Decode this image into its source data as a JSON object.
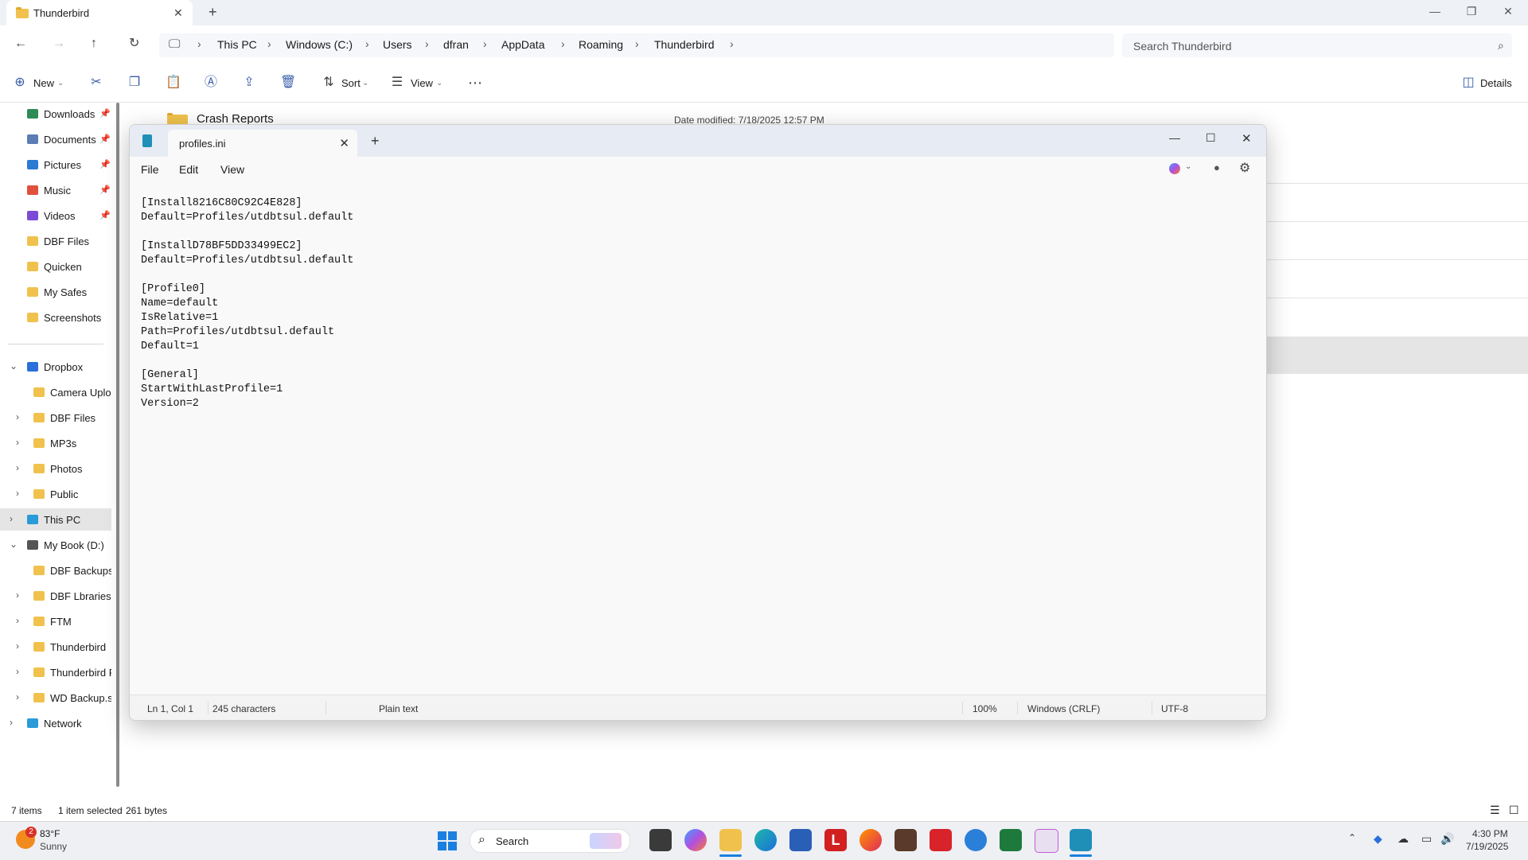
{
  "explorer": {
    "tab_title": "Thunderbird",
    "breadcrumbs": [
      "This PC",
      "Windows (C:)",
      "Users",
      "dfran",
      "AppData",
      "Roaming",
      "Thunderbird"
    ],
    "search_placeholder": "Search Thunderbird",
    "commands": {
      "new": "New",
      "sort": "Sort",
      "view": "View",
      "details": "Details"
    },
    "background_file": {
      "name": "Crash Reports",
      "date_modified": "Date modified: 7/18/2025 12:57 PM"
    },
    "sidebar": {
      "quick_access": [
        {
          "label": "Downloads",
          "pinned": true,
          "color": "#2e8b57"
        },
        {
          "label": "Documents",
          "pinned": true,
          "color": "#5b7cb5"
        },
        {
          "label": "Pictures",
          "pinned": true,
          "color": "#2a7bd3"
        },
        {
          "label": "Music",
          "pinned": true,
          "color": "#e0503c"
        },
        {
          "label": "Videos",
          "pinned": true,
          "color": "#7b4bd6"
        },
        {
          "label": "DBF Files",
          "pinned": false,
          "color": "#f0c24d"
        },
        {
          "label": "Quicken",
          "pinned": false,
          "color": "#f0c24d"
        },
        {
          "label": "My Safes",
          "pinned": false,
          "color": "#f0c24d"
        },
        {
          "label": "Screenshots",
          "pinned": false,
          "color": "#f0c24d"
        }
      ],
      "tree": [
        {
          "label": "Dropbox",
          "chevron": "⌄",
          "indent": 0,
          "color": "#2a6fdb"
        },
        {
          "label": "Camera Uploa",
          "chevron": "",
          "indent": 1,
          "color": "#f0c24d"
        },
        {
          "label": "DBF Files",
          "chevron": "›",
          "indent": 1,
          "color": "#f0c24d"
        },
        {
          "label": "MP3s",
          "chevron": "›",
          "indent": 1,
          "color": "#f0c24d"
        },
        {
          "label": "Photos",
          "chevron": "›",
          "indent": 1,
          "color": "#f0c24d"
        },
        {
          "label": "Public",
          "chevron": "›",
          "indent": 1,
          "color": "#f0c24d"
        },
        {
          "label": "This PC",
          "chevron": "›",
          "indent": 0,
          "color": "#2a9bd8",
          "selected": true
        },
        {
          "label": "My Book (D:)",
          "chevron": "⌄",
          "indent": 0,
          "color": "#555555"
        },
        {
          "label": "DBF Backups",
          "chevron": "",
          "indent": 1,
          "color": "#f0c24d"
        },
        {
          "label": "DBF Lbraries",
          "chevron": "›",
          "indent": 1,
          "color": "#f0c24d"
        },
        {
          "label": "FTM",
          "chevron": "›",
          "indent": 1,
          "color": "#f0c24d"
        },
        {
          "label": "Thunderbird",
          "chevron": "›",
          "indent": 1,
          "color": "#f0c24d"
        },
        {
          "label": "Thunderbird P",
          "chevron": "›",
          "indent": 1,
          "color": "#f0c24d"
        },
        {
          "label": "WD Backup.sw",
          "chevron": "›",
          "indent": 1,
          "color": "#f0c24d"
        },
        {
          "label": "Network",
          "chevron": "›",
          "indent": 0,
          "color": "#2a9bd8"
        }
      ]
    },
    "status": {
      "items": "7 items",
      "selected": "1 item selected",
      "size": "261 bytes"
    }
  },
  "notepad": {
    "tab_title": "profiles.ini",
    "menu": [
      "File",
      "Edit",
      "View"
    ],
    "content": "[Install8216C80C92C4E828]\nDefault=Profiles/utdbtsul.default\n\n[InstallD78BF5DD33499EC2]\nDefault=Profiles/utdbtsul.default\n\n[Profile0]\nName=default\nIsRelative=1\nPath=Profiles/utdbtsul.default\nDefault=1\n\n[General]\nStartWithLastProfile=1\nVersion=2",
    "status": {
      "position": "Ln 1, Col 1",
      "characters": "245 characters",
      "format": "Plain text",
      "zoom": "100%",
      "line_ending": "Windows (CRLF)",
      "encoding": "UTF-8"
    }
  },
  "taskbar": {
    "weather_badge": "2",
    "temperature": "83°F",
    "condition": "Sunny",
    "search_label": "Search",
    "time": "4:30 PM",
    "date": "7/19/2025",
    "brand_letter": "L"
  }
}
